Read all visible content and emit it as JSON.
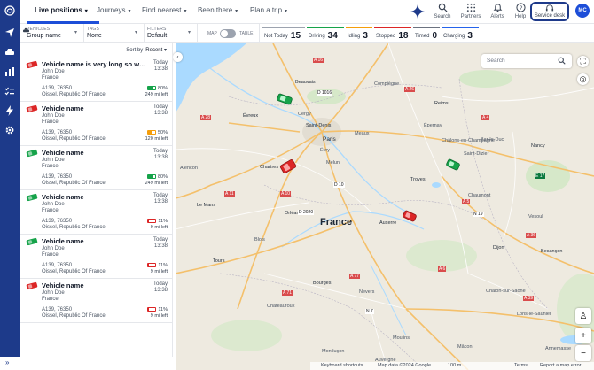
{
  "nav": {
    "tabs": [
      {
        "label": "Live positions"
      },
      {
        "label": "Journeys"
      },
      {
        "label": "Find nearest"
      },
      {
        "label": "Been there"
      },
      {
        "label": "Plan a trip"
      }
    ],
    "search_label": "Search",
    "partners_label": "Partners",
    "alerts_label": "Alerts",
    "help_label": "Help",
    "service_label": "Service desk",
    "avatar_initials": "MC"
  },
  "filters": {
    "vehicles_label": "VEHICLES",
    "vehicles_value": "Group name",
    "tags_label": "TAGS",
    "tags_value": "None",
    "filters_label": "FILTERS",
    "filters_value": "Default",
    "map_label": "MAP",
    "table_label": "TABLE"
  },
  "stats": [
    {
      "label": "Not Today",
      "count": "15",
      "color": "#9ca3af"
    },
    {
      "label": "Driving",
      "count": "34",
      "color": "#16a34a"
    },
    {
      "label": "Idling",
      "count": "3",
      "color": "#f59e0b"
    },
    {
      "label": "Stopped",
      "count": "18",
      "color": "#dc2626"
    },
    {
      "label": "Timed",
      "count": "0",
      "color": "#6b7280"
    },
    {
      "label": "Charging",
      "count": "3",
      "color": "#2563eb"
    }
  ],
  "list": {
    "sort_label": "Sort by",
    "sort_value": "Recent",
    "items": [
      {
        "name": "Vehicle name is very long so we n...",
        "driver": "John Doe",
        "country": "France",
        "road": "A139, 76350",
        "address": "Oissel, Republic Of France",
        "day": "Today",
        "time": "13:38",
        "battery": "80%",
        "range": "249 mi left",
        "status_color": "#dc2626",
        "battery_color": "#16a34a",
        "battery_fill": 0.8
      },
      {
        "name": "Vehicle name",
        "driver": "John Doe",
        "country": "France",
        "road": "A139, 76350",
        "address": "Oissel, Republic Of France",
        "day": "Today",
        "time": "13:38",
        "battery": "50%",
        "range": "120 mi left",
        "status_color": "#dc2626",
        "battery_color": "#f59e0b",
        "battery_fill": 0.5
      },
      {
        "name": "Vehicle name",
        "driver": "John Doe",
        "country": "France",
        "road": "A139, 76350",
        "address": "Oissel, Republic Of France",
        "day": "Today",
        "time": "13:38",
        "battery": "80%",
        "range": "249 mi left",
        "status_color": "#16a34a",
        "battery_color": "#16a34a",
        "battery_fill": 0.8
      },
      {
        "name": "Vehicle name",
        "driver": "John Doe",
        "country": "France",
        "road": "A139, 76350",
        "address": "Oissel, Republic Of France",
        "day": "Today",
        "time": "13:38",
        "battery": "11%",
        "range": "9 mi left",
        "status_color": "#16a34a",
        "battery_color": "#dc2626",
        "battery_fill": 0.11
      },
      {
        "name": "Vehicle name",
        "driver": "John Doe",
        "country": "France",
        "road": "A139, 76350",
        "address": "Oissel, Republic Of France",
        "day": "Today",
        "time": "13:38",
        "battery": "11%",
        "range": "9 mi left",
        "status_color": "#16a34a",
        "battery_color": "#dc2626",
        "battery_fill": 0.11
      },
      {
        "name": "Vehicle name",
        "driver": "John Doe",
        "country": "France",
        "road": "A139, 76350",
        "address": "Oissel, Republic Of France",
        "day": "Today",
        "time": "13:38",
        "battery": "11%",
        "range": "9 mi left",
        "status_color": "#dc2626",
        "battery_color": "#dc2626",
        "battery_fill": 0.11
      }
    ]
  },
  "map": {
    "search_placeholder": "Search",
    "country_label": "France",
    "place_labels": {
      "beauvais": "Beauvais",
      "compiegne": "Compiègne",
      "evreux": "Évreux",
      "cergy": "Cergy",
      "saint_denis": "Saint-Denis",
      "paris": "Paris",
      "meaux": "Meaux",
      "evry": "Évry",
      "chartres": "Chartres",
      "melun": "Melun",
      "reims": "Reims",
      "chalons": "Châlons-en-Champagne",
      "epernay": "Épernay",
      "bar_le_duc": "Bar-le-Duc",
      "nancy": "Nancy",
      "saint_dizier": "Saint-Dizier",
      "troyes": "Troyes",
      "chaumont": "Chaumont",
      "alencon": "Alençon",
      "le_mans": "Le Mans",
      "orleans": "Orléans",
      "auxerre": "Auxerre",
      "blois": "Blois",
      "tours": "Tours",
      "vesoul": "Vesoul",
      "dijon": "Dijon",
      "besancon": "Besançon",
      "bourges": "Bourges",
      "nevers": "Nevers",
      "chalon": "Chalon-sur-Saône",
      "chateauroux": "Châteauroux",
      "montlucon": "Montluçon",
      "lons": "Lons-le-Saunier",
      "annemasse": "Annemasse",
      "moulins": "Moulins",
      "auvergne": "Auvergne",
      "ml": "Mâcon"
    },
    "road_labels": [
      "A 16",
      "D 1016",
      "A 26",
      "A 28",
      "D 10",
      "A 10",
      "A 11",
      "D 2020",
      "A 4",
      "N 19",
      "A 36",
      "A 71",
      "A 77",
      "N 7",
      "A 5",
      "A 6",
      "A 39",
      "E 17"
    ],
    "attribution": [
      "Keyboard shortcuts",
      "Map data ©2024 Google",
      "100 m",
      "Terms",
      "Report a map error"
    ]
  }
}
